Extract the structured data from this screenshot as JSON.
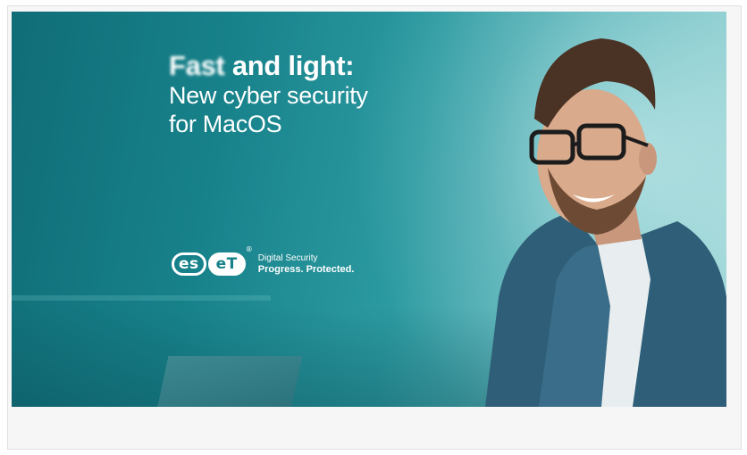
{
  "banner": {
    "headline_blurred": "Fast",
    "headline_rest": " and light:",
    "subline1": "New cyber security",
    "subline2": "for MacOS",
    "logo": {
      "left": "es",
      "right": "eT",
      "trademark": "®"
    },
    "tagline_top": "Digital Security",
    "tagline_bottom": "Progress. Protected."
  },
  "colors": {
    "teal_dark": "#106d77",
    "teal_mid": "#2c9aa1",
    "teal_light": "#a9dbdc",
    "text": "#ffffff",
    "card_bg": "#f6f6f7"
  }
}
